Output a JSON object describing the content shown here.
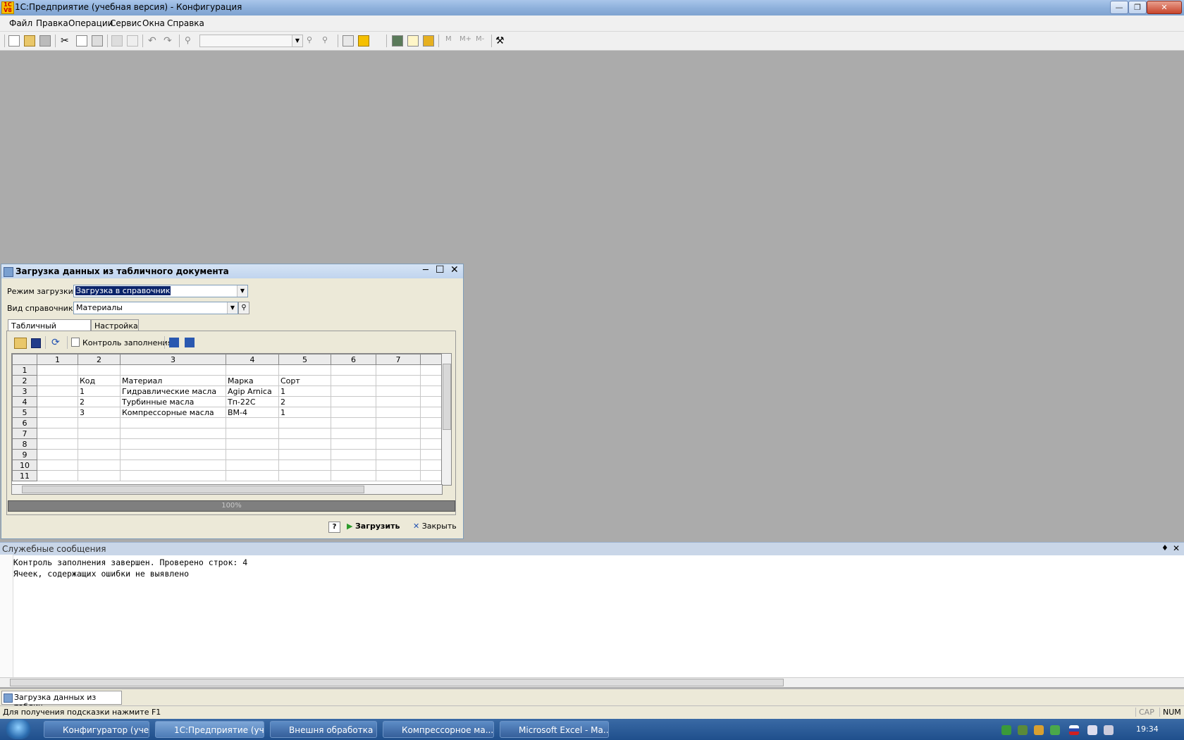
{
  "window": {
    "title": "1С:Предприятие (учебная версия) - Конфигурация"
  },
  "menu": [
    "Файл",
    "Правка",
    "Операции",
    "Сервис",
    "Окна",
    "Справка"
  ],
  "dialog": {
    "title": "Загрузка данных из табличного документа",
    "mode_label": "Режим загрузки:",
    "mode_value": "Загрузка в справочник",
    "ref_label": "Вид справочника:",
    "ref_value": "Материалы",
    "tabs": [
      "Табличный документ",
      "Настройка"
    ],
    "fill_control_label": "Контроль заполнения",
    "progress_text": "100%",
    "help_label": "?",
    "load_label": "Загрузить",
    "close_label": "Закрыть"
  },
  "sheet": {
    "col_headers": [
      "1",
      "2",
      "3",
      "4",
      "5",
      "6",
      "7"
    ],
    "rows": [
      {
        "n": "1",
        "cells": [
          "",
          "",
          "",
          "",
          ""
        ]
      },
      {
        "n": "2",
        "cells": [
          "",
          "Код",
          "Материал",
          "Марка",
          "Сорт"
        ]
      },
      {
        "n": "3",
        "cells": [
          "",
          "1",
          "Гидравлические масла",
          "Agip Arnica",
          "1"
        ]
      },
      {
        "n": "4",
        "cells": [
          "",
          "2",
          "Турбинные масла",
          "Тп-22С",
          "2"
        ]
      },
      {
        "n": "5",
        "cells": [
          "",
          "3",
          "Компрессорные масла",
          "ВМ-4",
          "1"
        ]
      },
      {
        "n": "6",
        "cells": [
          "",
          "",
          "",
          "",
          ""
        ]
      },
      {
        "n": "7",
        "cells": [
          "",
          "",
          "",
          "",
          ""
        ]
      },
      {
        "n": "8",
        "cells": [
          "",
          "",
          "",
          "",
          ""
        ]
      },
      {
        "n": "9",
        "cells": [
          "",
          "",
          "",
          "",
          ""
        ]
      },
      {
        "n": "10",
        "cells": [
          "",
          "",
          "",
          "",
          ""
        ]
      },
      {
        "n": "11",
        "cells": [
          "",
          "",
          "",
          "",
          ""
        ]
      }
    ]
  },
  "messages": {
    "title": "Служебные сообщения",
    "lines": [
      "Контроль заполнения завершен. Проверено строк: 4",
      "Ячеек, содержащих ошибки не выявлено"
    ]
  },
  "window_tab": "Загрузка данных из таблич...",
  "status": {
    "hint": "Для получения подсказки нажмите F1",
    "cap": "CAP",
    "num": "NUM"
  },
  "taskbar": {
    "tasks": [
      "Конфигуратор (уче...",
      "1С:Предприятие (уч...",
      "Внешня обработка ...",
      "Компрессорное ма...",
      "Microsoft Excel - Ма..."
    ],
    "clock": "19:34"
  }
}
